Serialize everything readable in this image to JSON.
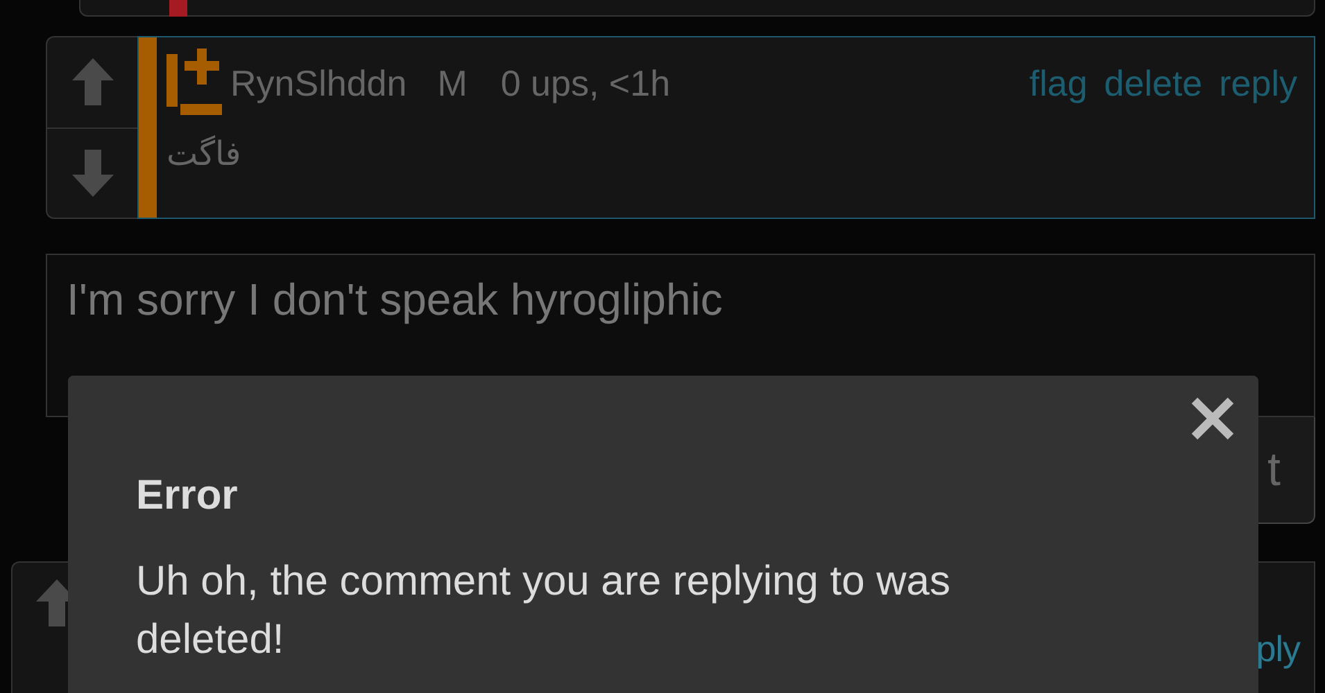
{
  "previous_comment": {
    "color": "#a61b22"
  },
  "comment": {
    "color": "#a65c00",
    "username": "RynSlhddn",
    "gender": "M",
    "meta": "0 ups, <1h",
    "actions": [
      "flag",
      "delete",
      "reply"
    ],
    "text": "فاگت"
  },
  "reply_box": {
    "value": "I'm sorry I don't speak hyrogliphic"
  },
  "submit_button": {
    "label": "t"
  },
  "next_comment": {
    "actions": [
      "ply"
    ]
  },
  "dialog": {
    "title": "Error",
    "message": "Uh oh, the comment you are replying to was deleted!"
  }
}
